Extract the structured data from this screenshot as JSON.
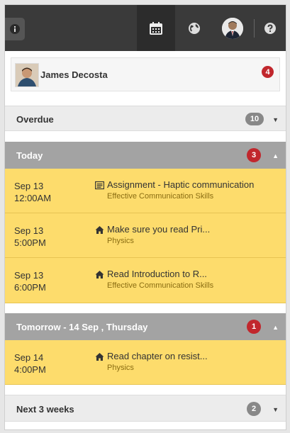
{
  "topbar": {
    "icons": [
      "info-icon",
      "calendar-icon",
      "globe-icon",
      "user-avatar",
      "help-icon"
    ]
  },
  "user": {
    "name": "James Decosta",
    "badge": "4"
  },
  "sections": {
    "overdue": {
      "title": "Overdue",
      "count": "10",
      "expanded": false
    },
    "today": {
      "title": "Today",
      "count": "3",
      "expanded": true
    },
    "tomorrow": {
      "title": "Tomorrow - 14 Sep , Thursday",
      "count": "1",
      "expanded": true
    },
    "next": {
      "title": "Next 3 weeks",
      "count": "2",
      "expanded": false
    }
  },
  "events": [
    {
      "date": "Sep 13",
      "time": "12:00AM",
      "icon": "assignment-icon",
      "title": "Assignment - Haptic communication",
      "course": "Effective Communication Skills"
    },
    {
      "date": "Sep 13",
      "time": "5:00PM",
      "icon": "home-icon",
      "title": "Make sure you read Pri...",
      "course": "Physics"
    },
    {
      "date": "Sep 13",
      "time": "6:00PM",
      "icon": "home-icon",
      "title": "Read Introduction to R...",
      "course": "Effective Communication Skills"
    },
    {
      "date": "Sep 14",
      "time": "4:00PM",
      "icon": "home-icon",
      "title": "Read chapter on resist...",
      "course": "Physics"
    }
  ],
  "colors": {
    "topbar": "#3a3a3a",
    "event_bg": "#fddc6c",
    "badge_red": "#c1272d",
    "badge_gray": "#888888",
    "dark_header": "#a3a3a3",
    "course_text": "#8a6d12"
  }
}
